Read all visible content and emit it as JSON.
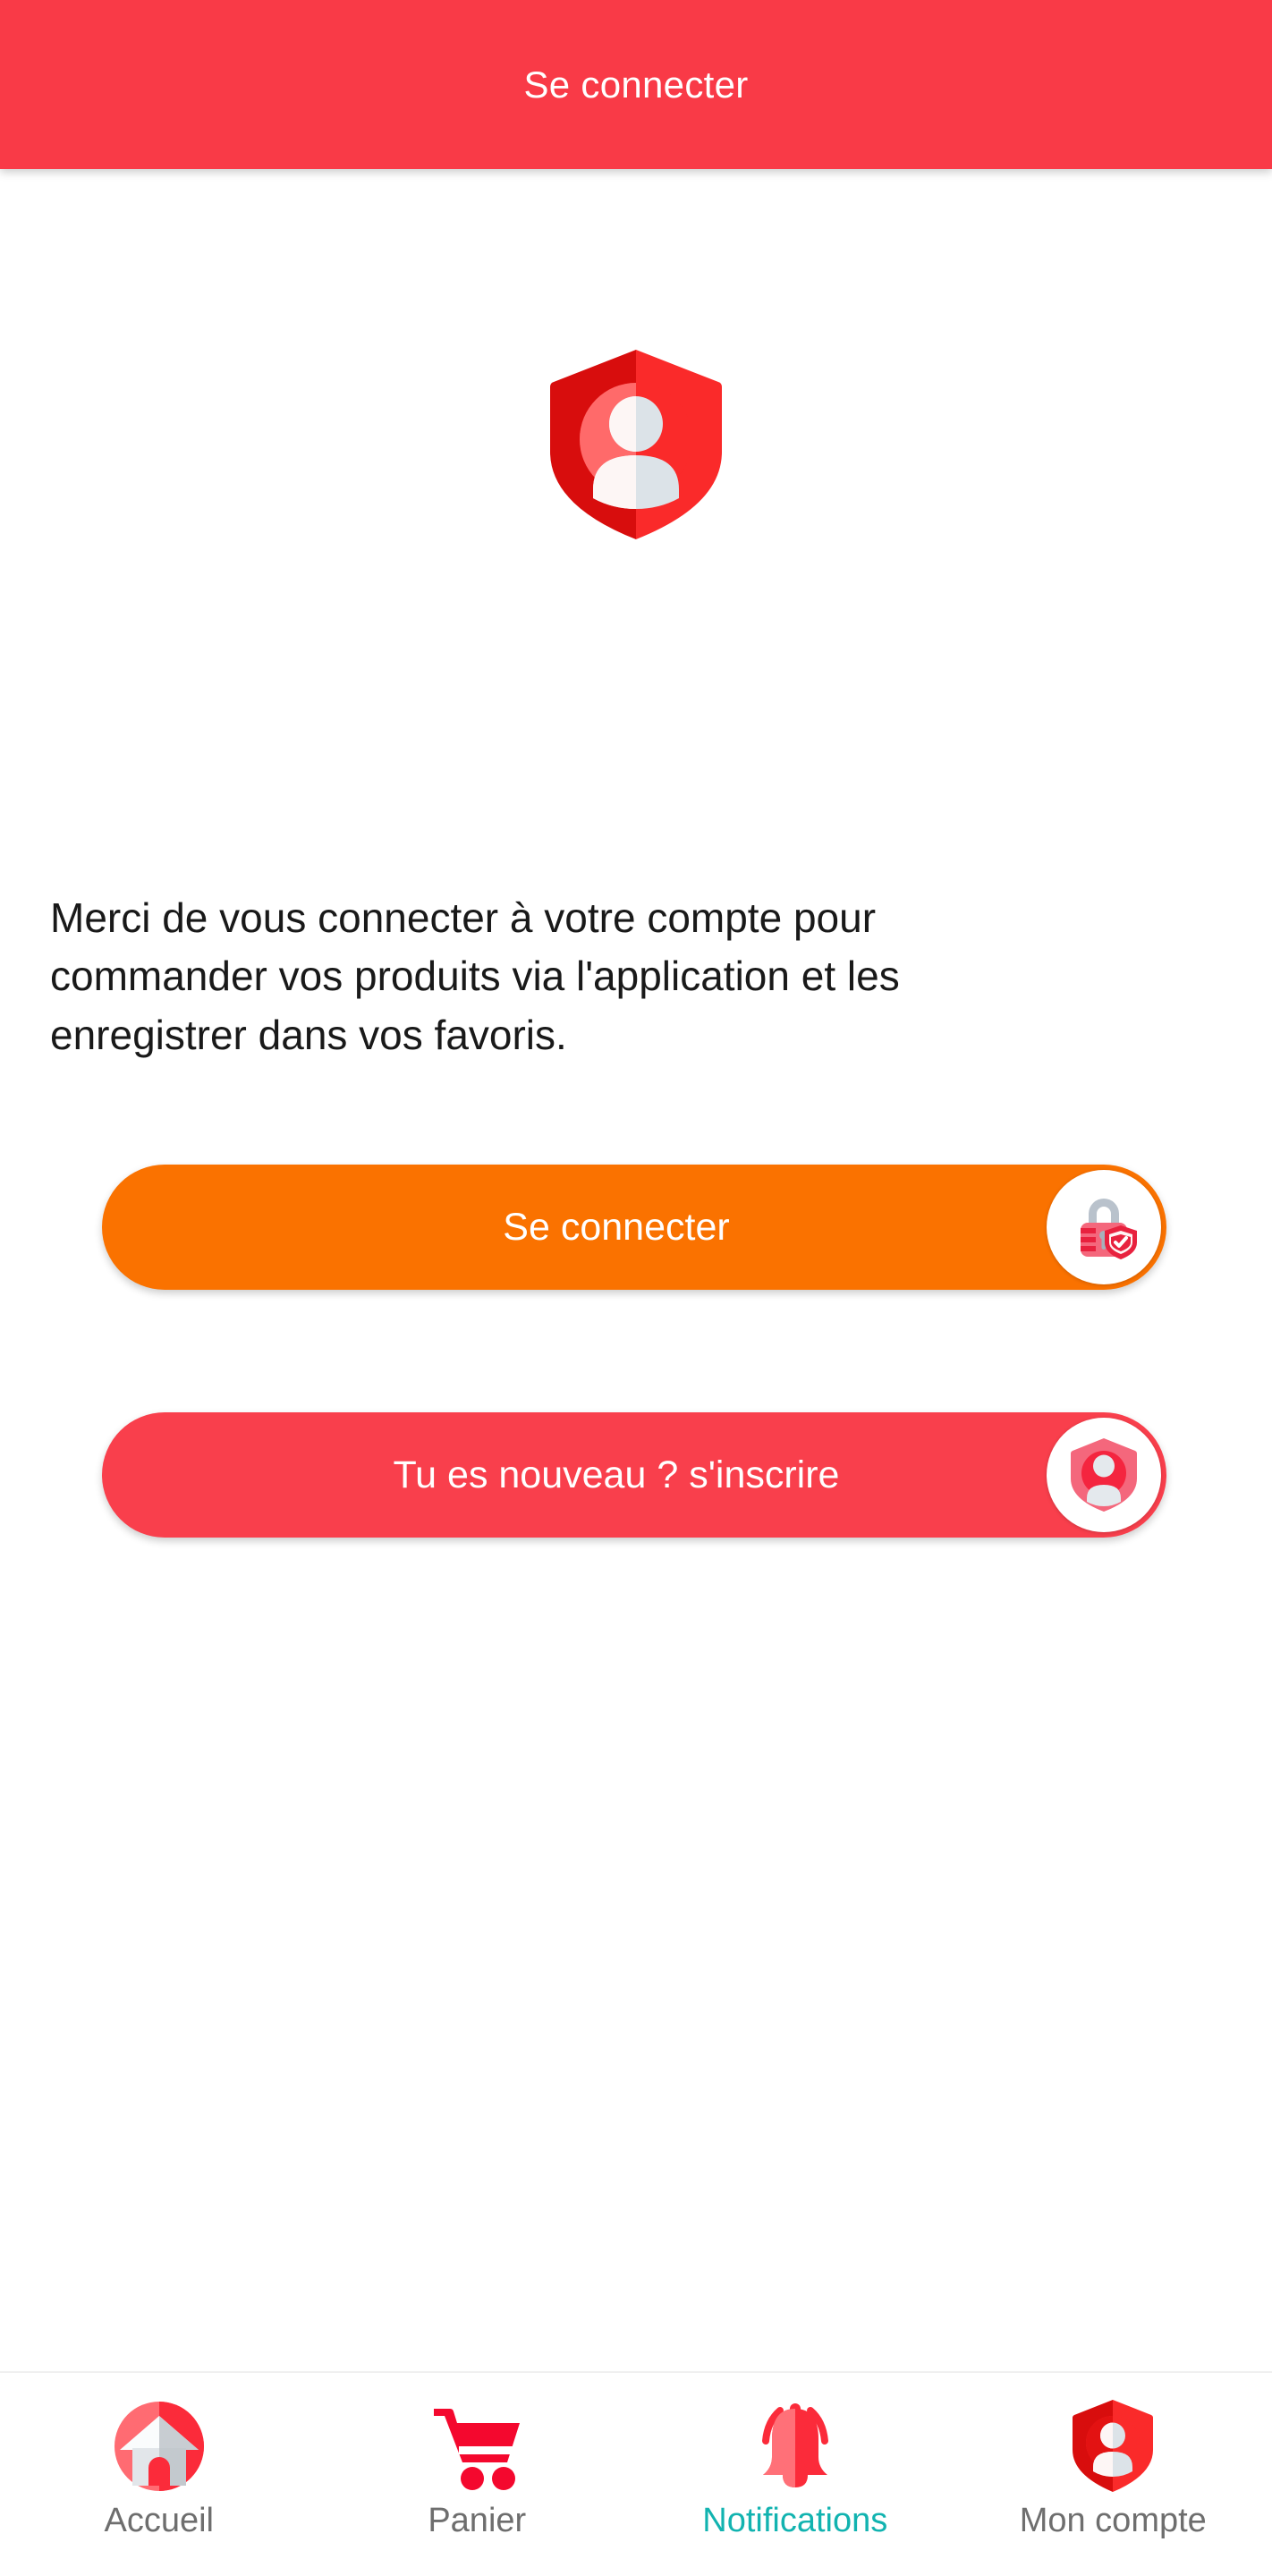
{
  "header": {
    "title": "Se connecter"
  },
  "main": {
    "hero_icon": "shield-person-icon",
    "intro_text": "Merci de vous connecter à votre compte pour commander vos produits via l'application et les enregistrer dans vos favoris.",
    "buttons": [
      {
        "id": "signin",
        "label": "Se connecter",
        "icon": "padlock-shield-check-icon",
        "color": "#FA7200"
      },
      {
        "id": "signup",
        "label": "Tu es nouveau ? s'inscrire",
        "icon": "shield-person-icon",
        "color": "#F93F4C"
      }
    ]
  },
  "bottom_nav": {
    "active_index": 2,
    "items": [
      {
        "label": "Accueil",
        "icon": "home-circle-icon",
        "active": false
      },
      {
        "label": "Panier",
        "icon": "shopping-cart-icon",
        "active": false
      },
      {
        "label": "Notifications",
        "icon": "bell-icon",
        "active": true
      },
      {
        "label": "Mon compte",
        "icon": "shield-person-icon",
        "active": false
      }
    ]
  },
  "colors": {
    "brand_red": "#F93A47",
    "accent_orange": "#FA7200",
    "active_teal": "#12B3B0",
    "inactive_gray": "#6E6E6E",
    "text_dark": "#191919"
  }
}
